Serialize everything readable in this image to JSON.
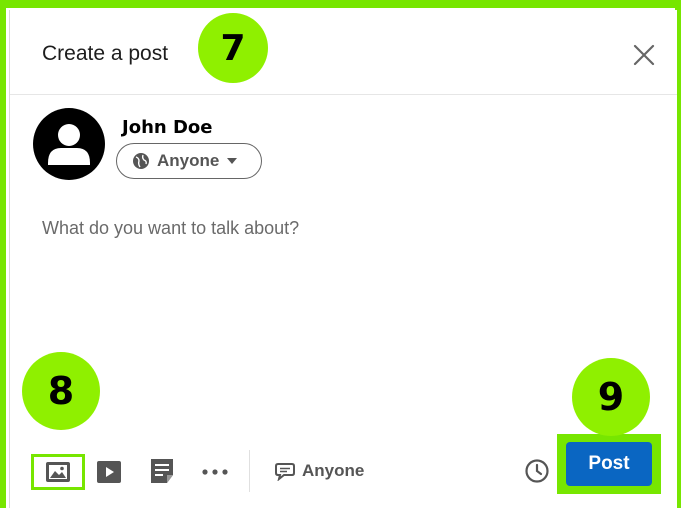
{
  "modal": {
    "title": "Create a post"
  },
  "author": {
    "name": "John Doe",
    "audience_label": "Anyone"
  },
  "composer": {
    "placeholder": "What do you want to talk about?"
  },
  "toolbar": {
    "comment_audience_label": "Anyone",
    "more_label": "•••",
    "post_label": "Post"
  },
  "annotations": {
    "step_7": "7",
    "step_8": "8",
    "step_9": "9"
  },
  "colors": {
    "accent": "#0a66c2",
    "highlight": "#77e600",
    "badge": "#8ff000",
    "text_muted": "#6a6a6a"
  },
  "icons": [
    "close-icon",
    "avatar-person-icon",
    "globe-icon",
    "caret-down-icon",
    "photo-icon",
    "video-icon",
    "document-icon",
    "more-icon",
    "comment-icon",
    "clock-icon"
  ]
}
